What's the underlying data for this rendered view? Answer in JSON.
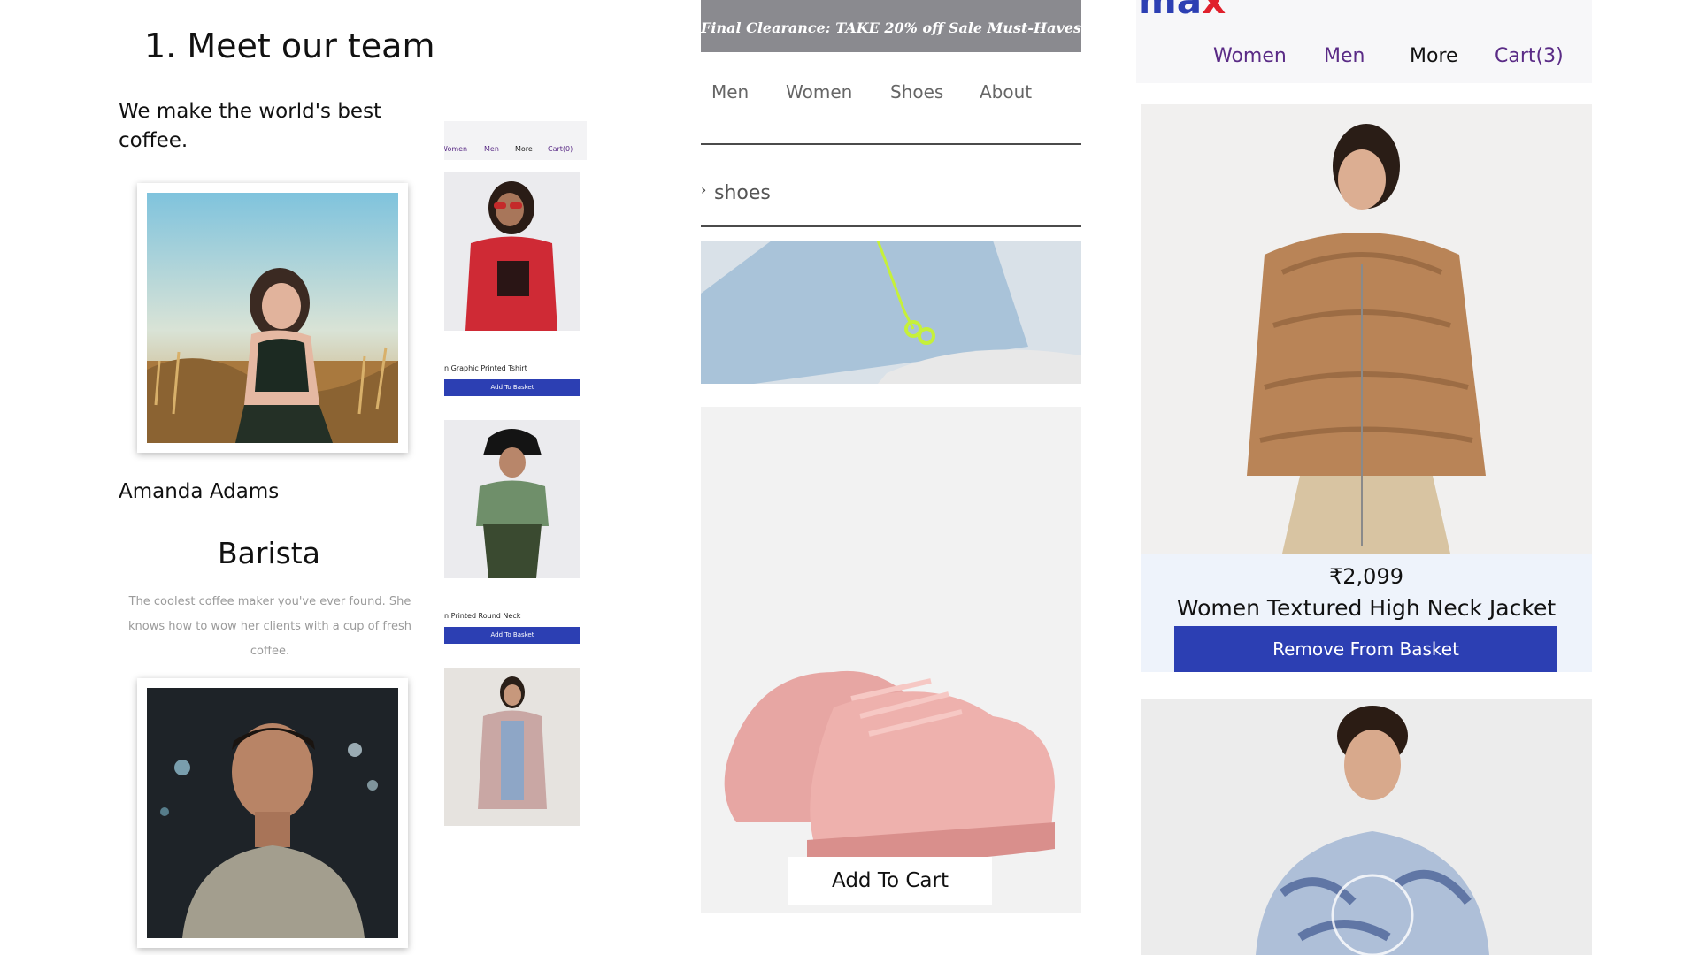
{
  "team_page": {
    "heading": "1. Meet our team",
    "tagline": "We make the world's best coffee.",
    "member": {
      "name": "Amanda Adams",
      "role": "Barista",
      "bio": "The coolest coffee maker you've ever found. She knows how to wow her clients with a cup of fresh coffee."
    }
  },
  "mini_store": {
    "nav": [
      "Women",
      "Men",
      "More",
      "Cart(0)"
    ],
    "products": [
      {
        "title": "n Graphic Printed Tshirt",
        "button": "Add To Basket"
      },
      {
        "title": "n Printed Round Neck",
        "button": "Add To Basket"
      }
    ]
  },
  "shoe_page": {
    "banner": {
      "before": "Final Clearance: ",
      "take": "TAKE",
      "after": " 20% off Sale Must-Haves"
    },
    "nav": [
      "Men",
      "Women",
      "Shoes",
      "About"
    ],
    "breadcrumb_chevron": "›",
    "breadcrumb": "shoes",
    "add_to_cart": "Add To Cart"
  },
  "max_store": {
    "logo": "max",
    "logo_colors": {
      "m": "#2c3fb3",
      "a": "#2c3fb3",
      "x": "#e0202c"
    },
    "nav": [
      "Women",
      "Men",
      "More",
      "Cart(3)"
    ],
    "product": {
      "price": "₹2,099",
      "name": "Women Textured High Neck Jacket",
      "button": "Remove From Basket"
    }
  },
  "colors": {
    "accent_blue": "#2c3fb3",
    "nav_purple": "#5a2b86",
    "banner_gray": "#8a8a8f",
    "muted_text": "#9b9b9b"
  }
}
